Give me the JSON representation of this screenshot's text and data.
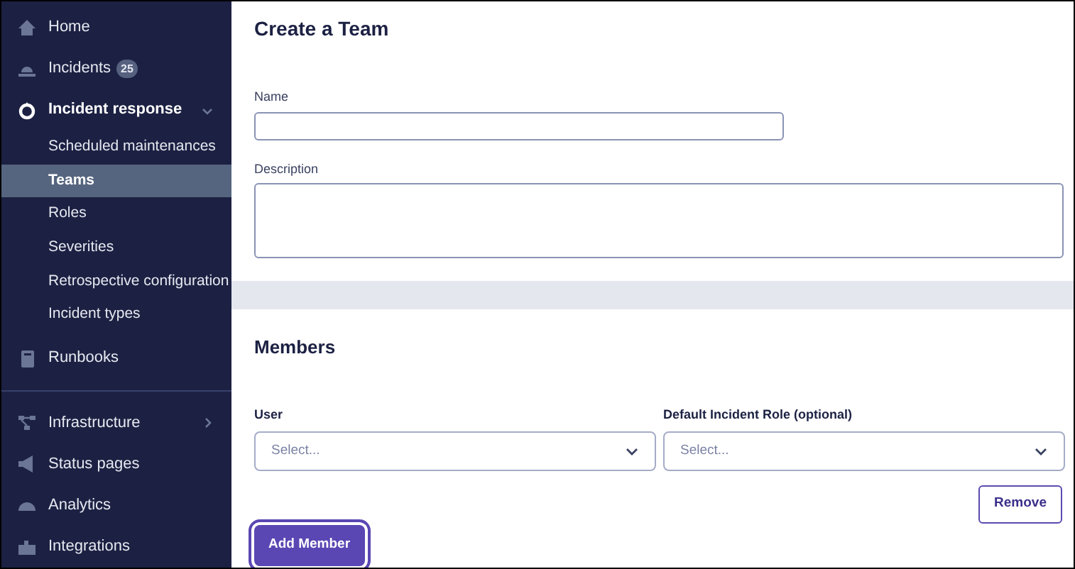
{
  "sidebar": {
    "sections": [
      [
        {
          "label": "Home"
        },
        {
          "label": "Incidents",
          "badge": "25"
        },
        {
          "label": "Incident response",
          "expanded": true,
          "children": [
            {
              "label": "Scheduled maintenances",
              "selected": false
            },
            {
              "label": "Teams",
              "selected": true
            },
            {
              "label": "Roles",
              "selected": false
            },
            {
              "label": "Severities",
              "selected": false
            },
            {
              "label": "Retrospective configuration",
              "selected": false
            },
            {
              "label": "Incident types",
              "selected": false
            }
          ]
        },
        {
          "label": "Runbooks"
        }
      ],
      [
        {
          "label": "Infrastructure",
          "expanded": false
        },
        {
          "label": "Status pages"
        },
        {
          "label": "Analytics"
        },
        {
          "label": "Integrations"
        }
      ]
    ]
  },
  "form": {
    "title": "Create a Team",
    "name_field": {
      "label": "Name"
    },
    "description_field": {
      "label": "Description"
    }
  },
  "members": {
    "title": "Members",
    "user_field": {
      "label": "User",
      "placeholder": "Select..."
    },
    "role_field": {
      "label": "Default Incident Role (optional)",
      "placeholder": "Select..."
    },
    "remove_button": "Remove",
    "add_button": "Add Member"
  }
}
